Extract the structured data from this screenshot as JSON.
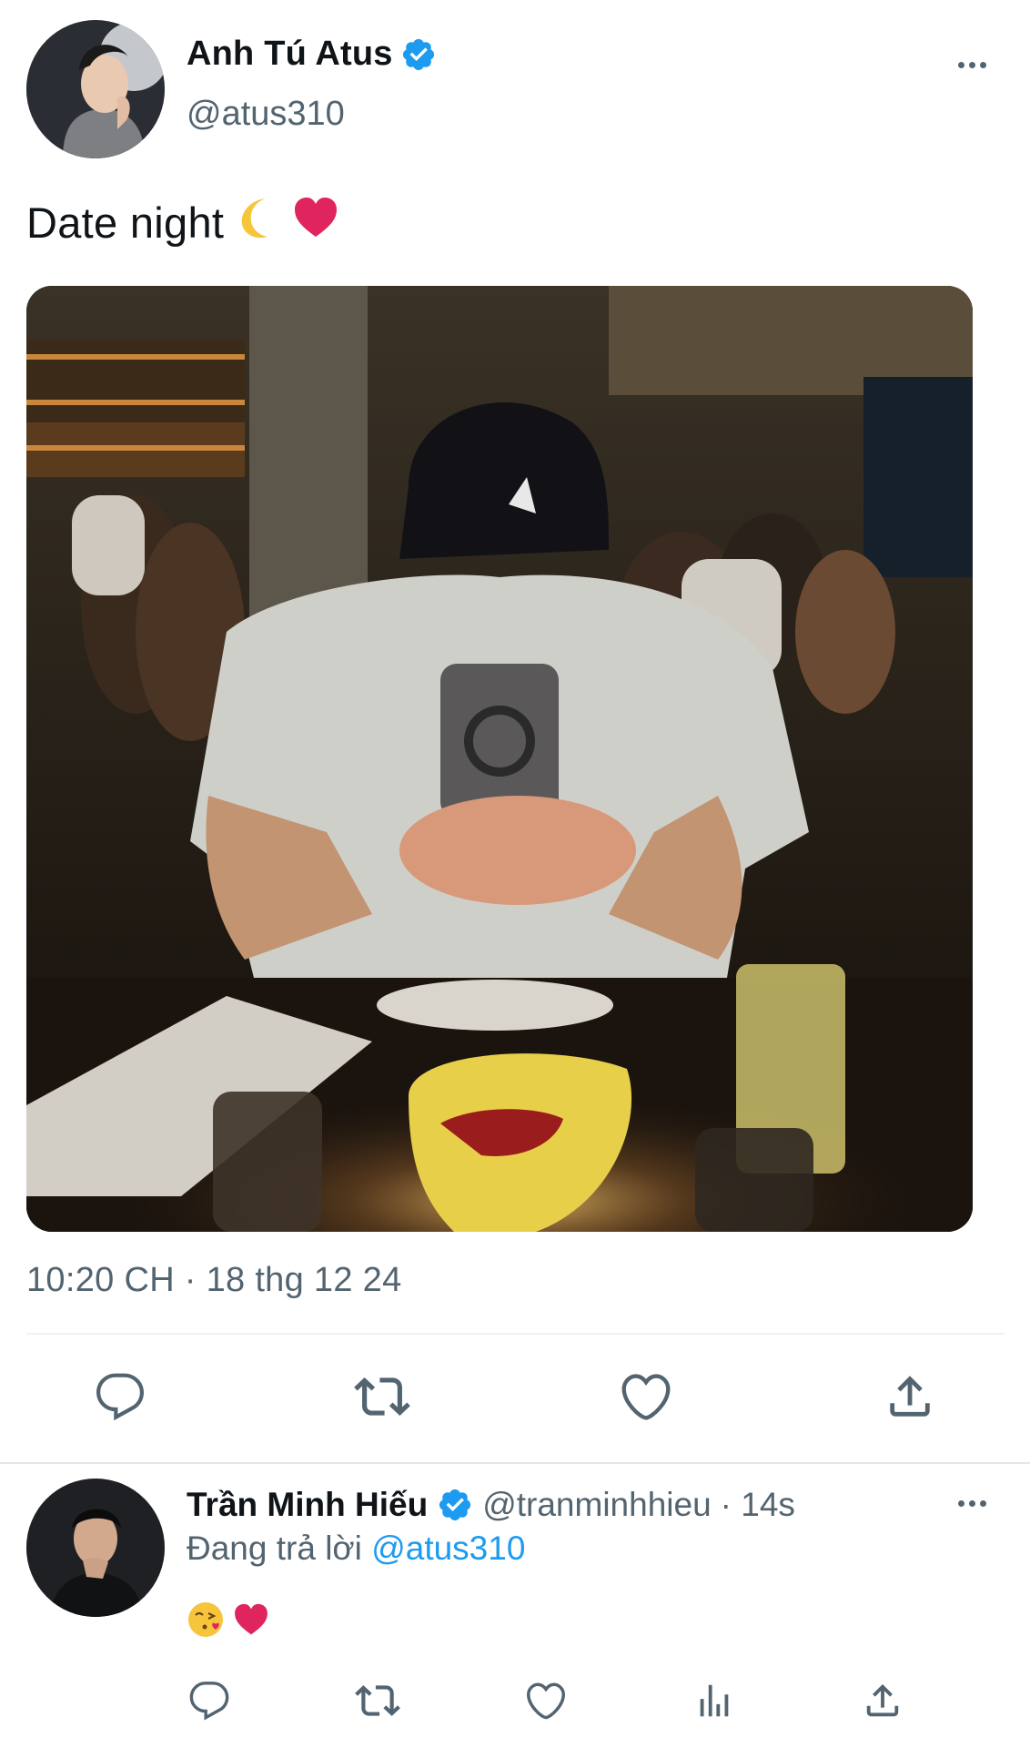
{
  "tweet": {
    "author": {
      "display_name": "Anh Tú Atus",
      "handle": "@atus310",
      "verified": true,
      "avatar_icon": "avatar-photo"
    },
    "text": "Date night",
    "emojis": [
      "crescent-moon-emoji",
      "red-heart-emoji"
    ],
    "media": {
      "type": "photo",
      "description_icon": "restaurant-photo"
    },
    "timestamp": "10:20 CH · 18 thg 12 24",
    "actions": [
      {
        "name": "reply",
        "icon": "reply-icon"
      },
      {
        "name": "retweet",
        "icon": "retweet-icon"
      },
      {
        "name": "like",
        "icon": "heart-icon"
      },
      {
        "name": "share",
        "icon": "share-icon"
      }
    ]
  },
  "reply": {
    "author": {
      "display_name": "Trần Minh Hiếu",
      "handle": "@tranminhhieu",
      "verified": true,
      "avatar_icon": "avatar-photo"
    },
    "time": "· 14s",
    "replying_prefix": "Đang trả lời",
    "replying_to": "@atus310",
    "emojis": [
      "kissing-face-emoji",
      "red-heart-emoji"
    ],
    "actions": [
      {
        "name": "reply",
        "icon": "reply-icon"
      },
      {
        "name": "retweet",
        "icon": "retweet-icon"
      },
      {
        "name": "like",
        "icon": "heart-icon"
      },
      {
        "name": "analytics",
        "icon": "analytics-icon"
      },
      {
        "name": "share",
        "icon": "share-icon"
      }
    ]
  },
  "colors": {
    "verified_blue": "#1d9bf0",
    "text_primary": "#0f1419",
    "text_secondary": "#536471",
    "heart_red": "#e0245e",
    "mention_blue": "#1d9bf0"
  }
}
